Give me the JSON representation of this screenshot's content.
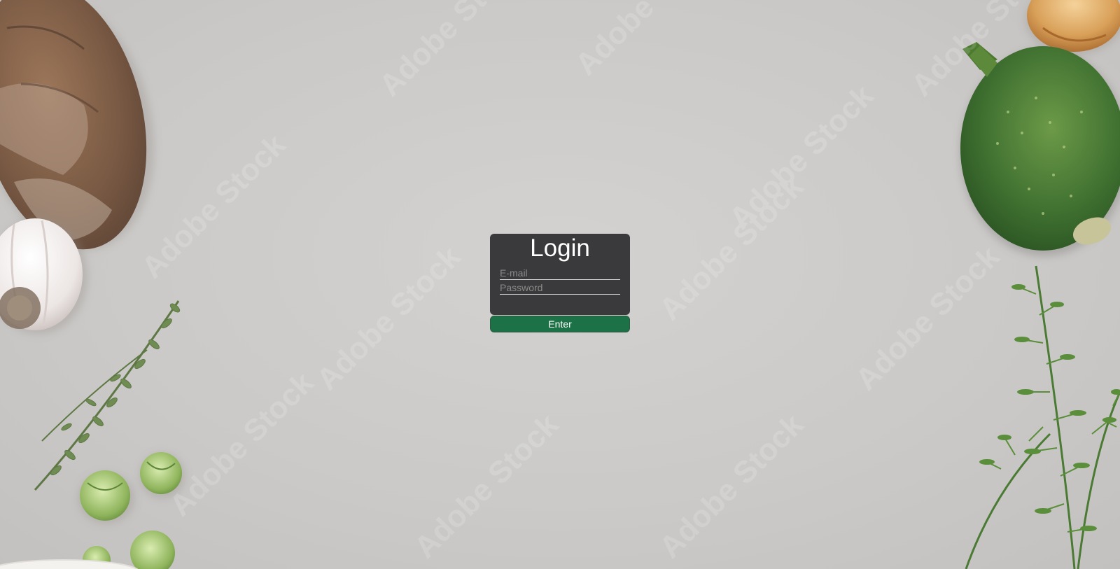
{
  "login": {
    "title": "Login",
    "email_placeholder": "E-mail",
    "password_placeholder": "Password",
    "submit_label": "Enter"
  },
  "background": {
    "watermark_text": "Adobe Stock",
    "items": [
      "bread",
      "garlic",
      "thyme",
      "brussels-sprouts",
      "onion",
      "round-zucchini",
      "carrot-greens"
    ]
  },
  "colors": {
    "card": "#3a3a3c",
    "button": "#1c7146",
    "surface": "#cbc9c7"
  }
}
